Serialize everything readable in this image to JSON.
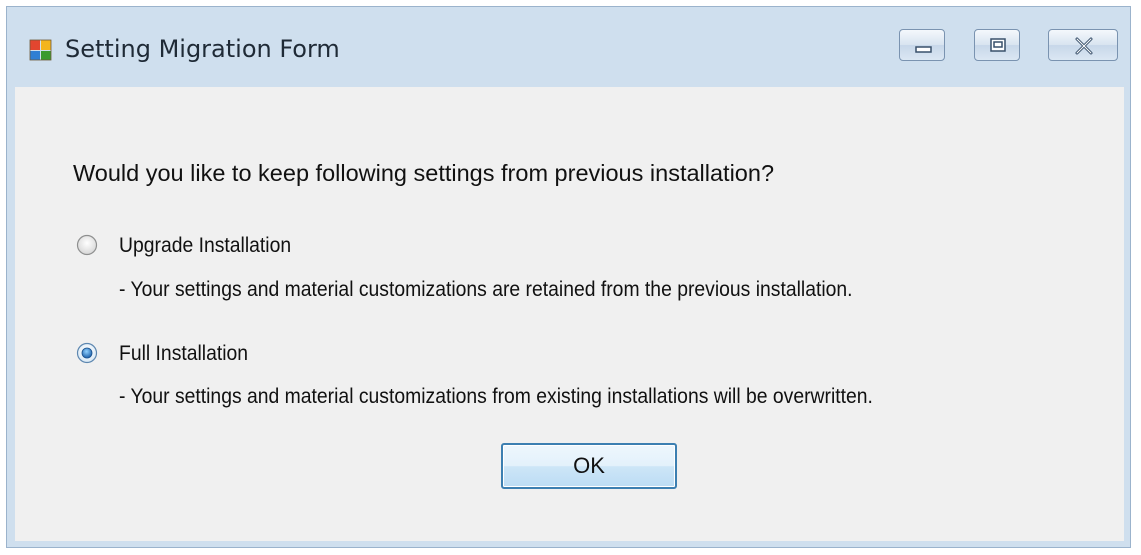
{
  "window": {
    "title": "Setting Migration Form",
    "app_icon": "windows-form-app-icon",
    "controls": {
      "minimize_icon": "minimize-icon",
      "maximize_icon": "maximize-icon",
      "close_icon": "close-icon"
    }
  },
  "dialog": {
    "question": "Would you like to keep following settings from previous installation?",
    "options": [
      {
        "label": "Upgrade Installation",
        "description": "- Your settings and material customizations are retained from the previous installation.",
        "selected": false
      },
      {
        "label": "Full Installation",
        "description": "- Your settings and material customizations from existing installations will be overwritten.",
        "selected": true
      }
    ],
    "ok_label": "OK"
  },
  "colors": {
    "title_bar": "#cfdfee",
    "client_area": "#f0f0f0",
    "ok_border": "#3c7fb1",
    "radio_selected_dot": "#1c5fa8"
  }
}
